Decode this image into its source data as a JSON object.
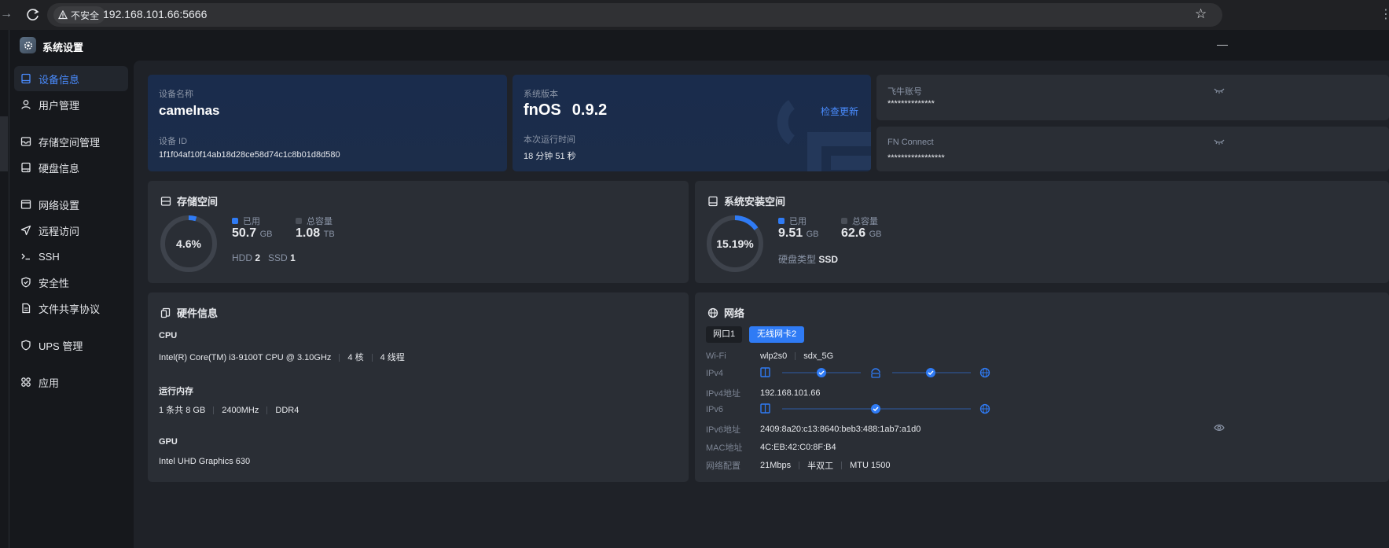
{
  "browser": {
    "insecure_label": "不安全",
    "url": "192.168.101.66:5666"
  },
  "app": {
    "title": "系统设置"
  },
  "sidebar": {
    "items": [
      {
        "label": "设备信息",
        "icon": "device-info-icon",
        "active": true
      },
      {
        "label": "用户管理",
        "icon": "user-icon"
      },
      {
        "label": "存储空间管理",
        "icon": "storage-icon"
      },
      {
        "label": "硬盘信息",
        "icon": "disk-icon"
      },
      {
        "label": "网络设置",
        "icon": "network-icon"
      },
      {
        "label": "远程访问",
        "icon": "remote-icon"
      },
      {
        "label": "SSH",
        "icon": "ssh-icon"
      },
      {
        "label": "安全性",
        "icon": "shield-icon"
      },
      {
        "label": "文件共享协议",
        "icon": "file-share-icon"
      },
      {
        "label": "UPS 管理",
        "icon": "ups-icon"
      },
      {
        "label": "应用",
        "icon": "apps-icon"
      }
    ]
  },
  "device": {
    "name_label": "设备名称",
    "name": "camelnas",
    "id_label": "设备 ID",
    "id": "1f1f04af10f14ab18d28ce58d74c1c8b01d8d580"
  },
  "system": {
    "version_label": "系统版本",
    "os": "fnOS",
    "version": "0.9.2",
    "check_update": "检查更新",
    "uptime_label": "本次运行时间",
    "uptime": "18 分钟 51 秒"
  },
  "account": {
    "feiniu_label": "飞牛账号",
    "feiniu_value": "**************",
    "fnconnect_label": "FN Connect",
    "fnconnect_value": "*****************"
  },
  "storage": {
    "title": "存储空间",
    "percent": "4.6%",
    "percent_value": 4.6,
    "used_label": "已用",
    "used": "50.7",
    "used_unit": "GB",
    "total_label": "总容量",
    "total": "1.08",
    "total_unit": "TB",
    "hdd_label": "HDD",
    "hdd": "2",
    "ssd_label": "SSD",
    "ssd": "1"
  },
  "sysdisk": {
    "title": "系统安装空间",
    "percent": "15.19%",
    "percent_value": 15.19,
    "used_label": "已用",
    "used": "9.51",
    "used_unit": "GB",
    "total_label": "总容量",
    "total": "62.6",
    "total_unit": "GB",
    "disk_type_label": "硬盘类型",
    "disk_type": "SSD"
  },
  "hardware": {
    "title": "硬件信息",
    "cpu_label": "CPU",
    "cpu_model": "Intel(R) Core(TM) i3-9100T CPU @ 3.10GHz",
    "cpu_cores": "4 核",
    "cpu_threads": "4 线程",
    "mem_label": "运行内存",
    "mem_size": "1 条共 8 GB",
    "mem_freq": "2400MHz",
    "mem_type": "DDR4",
    "gpu_label": "GPU",
    "gpu_model": "Intel UHD Graphics 630"
  },
  "network": {
    "title": "网络",
    "tabs": [
      {
        "label": "网口1",
        "active": false
      },
      {
        "label": "无线网卡2",
        "active": true
      }
    ],
    "wifi_label": "Wi-Fi",
    "wifi_iface": "wlp2s0",
    "wifi_ssid": "sdx_5G",
    "ipv4_label": "IPv4",
    "ipv4_addr_label": "IPv4地址",
    "ipv4_addr": "192.168.101.66",
    "ipv6_label": "IPv6",
    "ipv6_addr_label": "IPv6地址",
    "ipv6_addr": "2409:8a20:c13:8640:beb3:488:1ab7:a1d0",
    "mac_label": "MAC地址",
    "mac": "4C:EB:42:C0:8F:B4",
    "config_label": "网络配置",
    "speed": "21Mbps",
    "duplex": "半双工",
    "mtu": "MTU 1500"
  },
  "colors": {
    "accent": "#2f7bf5",
    "used": "#2f7bf5",
    "total": "#4a4f58"
  }
}
